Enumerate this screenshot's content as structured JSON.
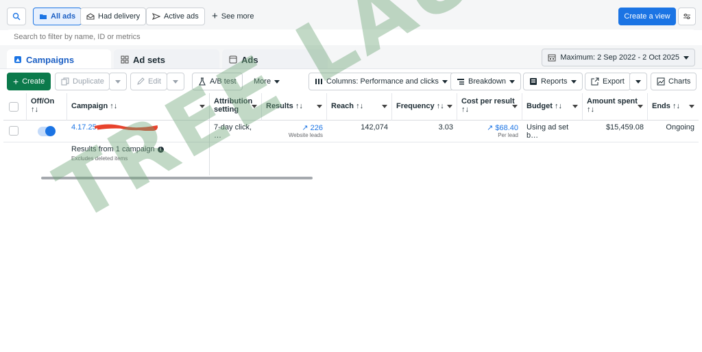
{
  "filters": {
    "all_ads": "All ads",
    "had_delivery": "Had delivery",
    "active_ads": "Active ads",
    "see_more": "See more",
    "create_view": "Create a view"
  },
  "search": {
    "placeholder": "Search to filter by name, ID or metrics"
  },
  "tabs": {
    "campaigns": "Campaigns",
    "ad_sets": "Ad sets",
    "ads": "Ads"
  },
  "date_range": "Maximum: 2 Sep 2022 - 2 Oct 2025",
  "toolbar": {
    "create": "Create",
    "duplicate": "Duplicate",
    "edit": "Edit",
    "ab_test": "A/B test",
    "more": "More",
    "columns": "Columns: Performance and clicks",
    "breakdown": "Breakdown",
    "reports": "Reports",
    "export": "Export",
    "charts": "Charts"
  },
  "table": {
    "headers": {
      "off_on": "Off/On",
      "campaign": "Campaign",
      "attribution_line1": "Attribution",
      "attribution_line2": "setting",
      "results": "Results",
      "reach": "Reach",
      "frequency": "Frequency",
      "cost_per_result": "Cost per result",
      "budget": "Budget",
      "amount_spent": "Amount spent",
      "ends": "Ends",
      "sort_glyph": "↑↓"
    },
    "row": {
      "toggle_on": true,
      "campaign_name": "4.17.25",
      "attribution": "7-day click, …",
      "results": "226",
      "results_sub": "Website leads",
      "reach": "142,074",
      "frequency": "3.03",
      "cost_per_result": "$68.40",
      "cost_sub": "Per lead",
      "budget": "Using ad set b…",
      "amount_spent": "$15,459.08",
      "ends": "Ongoing"
    },
    "summary": {
      "title": "Results from 1 campaign",
      "note": "Excludes deleted items"
    }
  },
  "watermark": "TREE LAUNCH",
  "colors": {
    "accent": "#1b74e4",
    "create_green": "#0b7a4b",
    "watermark": "#6ea578"
  }
}
